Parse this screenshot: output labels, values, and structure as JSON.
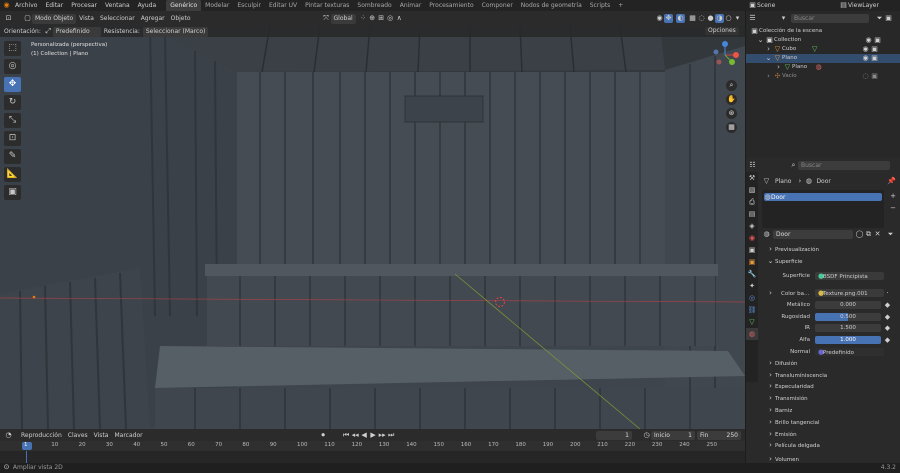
{
  "topbar": {
    "menus": [
      "Archivo",
      "Editar",
      "Procesar",
      "Ventana",
      "Ayuda"
    ],
    "workspaces": [
      "Genérico",
      "Modelar",
      "Esculpir",
      "Editar UV",
      "Pintar texturas",
      "Sombreado",
      "Animar",
      "Procesamiento",
      "Componer",
      "Nodos de geometría",
      "Scripts"
    ],
    "active_workspace": "Genérico",
    "add_tab": "+",
    "scene": "Scene",
    "viewlayer": "ViewLayer"
  },
  "viewport_header": {
    "mode": "Modo Objeto",
    "menus": [
      "Vista",
      "Seleccionar",
      "Agregar",
      "Objeto"
    ],
    "transform": "Global"
  },
  "tool_header": {
    "orientation_label": "Orientación:",
    "orientation_value": "Predefinido",
    "drag_label": "Resistencia:",
    "drag_value": "Seleccionar (Marco)",
    "options": "Opciones"
  },
  "viewport_info": {
    "line1": "Personalizada (perspectiva)",
    "line2": "(1) Collection | Plano"
  },
  "timeline": {
    "menus": [
      "Reproducción",
      "Claves",
      "Vista",
      "Marcador"
    ],
    "current_frame": "1",
    "start_label": "Inicio",
    "start_value": "1",
    "end_label": "Fin",
    "end_value": "250",
    "ticks": [
      "1",
      "10",
      "20",
      "30",
      "40",
      "50",
      "60",
      "70",
      "80",
      "90",
      "100",
      "110",
      "120",
      "130",
      "140",
      "150",
      "160",
      "170",
      "180",
      "190",
      "200",
      "210",
      "220",
      "230",
      "240",
      "250"
    ]
  },
  "statusbar": {
    "hint": "Ampliar vista 2D",
    "version": "4.3.2"
  },
  "outliner": {
    "search_placeholder": "Buscar",
    "rows": [
      {
        "label": "Colección de la escena",
        "indent": 0
      },
      {
        "label": "Collection",
        "indent": 1
      },
      {
        "label": "Cubo",
        "indent": 2
      },
      {
        "label": "Plano",
        "indent": 2
      },
      {
        "label": "Plano",
        "indent": 3
      },
      {
        "label": "Vacío",
        "indent": 2
      }
    ]
  },
  "properties": {
    "search_placeholder": "Buscar",
    "breadcrumb_object": "Plano",
    "breadcrumb_material": "Door",
    "material_slot": "Door",
    "material_name": "Door",
    "sections": {
      "preview": "Previsualización",
      "surface": "Superficie",
      "diffusion": "Difusión",
      "transmission_sub": "Translumíniscencia",
      "specular": "Especularidad",
      "transmission": "Transmisión",
      "coat": "Barniz",
      "sheen": "Brillo tangencial",
      "emission": "Emisión",
      "thin_film": "Película delgada",
      "volume": "Volumen"
    },
    "fields": {
      "surface_label": "Superficie",
      "surface_value": "BSDF Principista",
      "base_color_label": "Color ba...",
      "base_color_value": "Texture.png.001",
      "metallic_label": "Metálico",
      "metallic_value": "0.000",
      "roughness_label": "Rugosidad",
      "roughness_value": "0.500",
      "ior_label": "IR",
      "ior_value": "1.500",
      "alpha_label": "Alfa",
      "alpha_value": "1.000",
      "normal_label": "Normal",
      "normal_value": "Predefinido"
    }
  },
  "colors": {
    "accent": "#4772b3",
    "viewport_bg": "#3f454c",
    "panel": "#2a2a2a"
  }
}
